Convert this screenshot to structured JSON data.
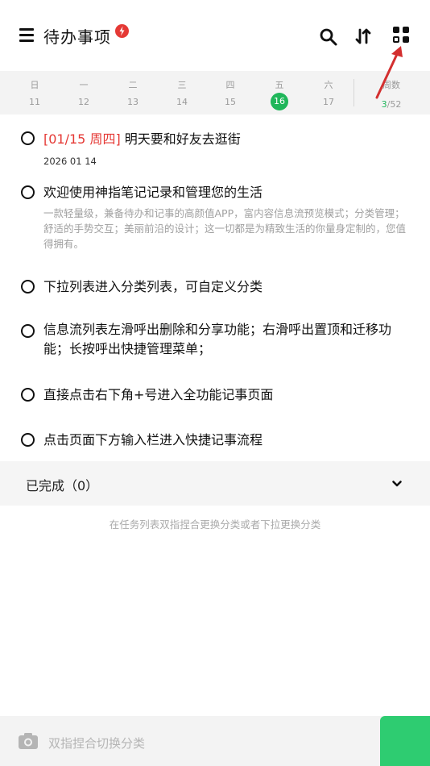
{
  "header": {
    "title": "待办事项",
    "badge_icon": "lightning-badge-icon",
    "actions": [
      "search-icon",
      "sort-icon",
      "grid-view-icon"
    ]
  },
  "week": {
    "days": [
      {
        "name": "日",
        "date": "11"
      },
      {
        "name": "一",
        "date": "12"
      },
      {
        "name": "二",
        "date": "13"
      },
      {
        "name": "三",
        "date": "14"
      },
      {
        "name": "四",
        "date": "15"
      },
      {
        "name": "五",
        "date": "16",
        "today": true
      },
      {
        "name": "六",
        "date": "17"
      }
    ],
    "weeknum_label": "周数",
    "weeknum_current": "3",
    "weeknum_total": "/52",
    "today_color": "#1fb65a"
  },
  "tasks": [
    {
      "date_tag": "[01/15 周四]",
      "title": "明天要和好友去逛街",
      "sub": "2026 01 14"
    },
    {
      "title": "欢迎使用神指笔记记录和管理您的生活",
      "desc": "一款轻量级，兼备待办和记事的高颜值APP，富内容信息流预览模式；分类管理；舒适的手势交互；美丽前沿的设计；这一切都是为精致生活的你量身定制的，您值得拥有。"
    },
    {
      "title": "下拉列表进入分类列表，可自定义分类"
    },
    {
      "title": "信息流列表左滑呼出删除和分享功能；右滑呼出置顶和迁移功能；长按呼出快捷管理菜单；"
    },
    {
      "title": "直接点击右下角+号进入全功能记事页面"
    },
    {
      "title": "点击页面下方输入栏进入快捷记事流程"
    }
  ],
  "completed": {
    "label": "已完成（0）"
  },
  "hint": "在任务列表双指捏合更换分类或者下拉更换分类",
  "bottom": {
    "placeholder": "双指捏合切换分类",
    "camera_icon": "camera-icon"
  },
  "colors": {
    "accent": "#2ecc71",
    "date_red": "#e53935",
    "annotation_arrow": "#d32f2f"
  }
}
